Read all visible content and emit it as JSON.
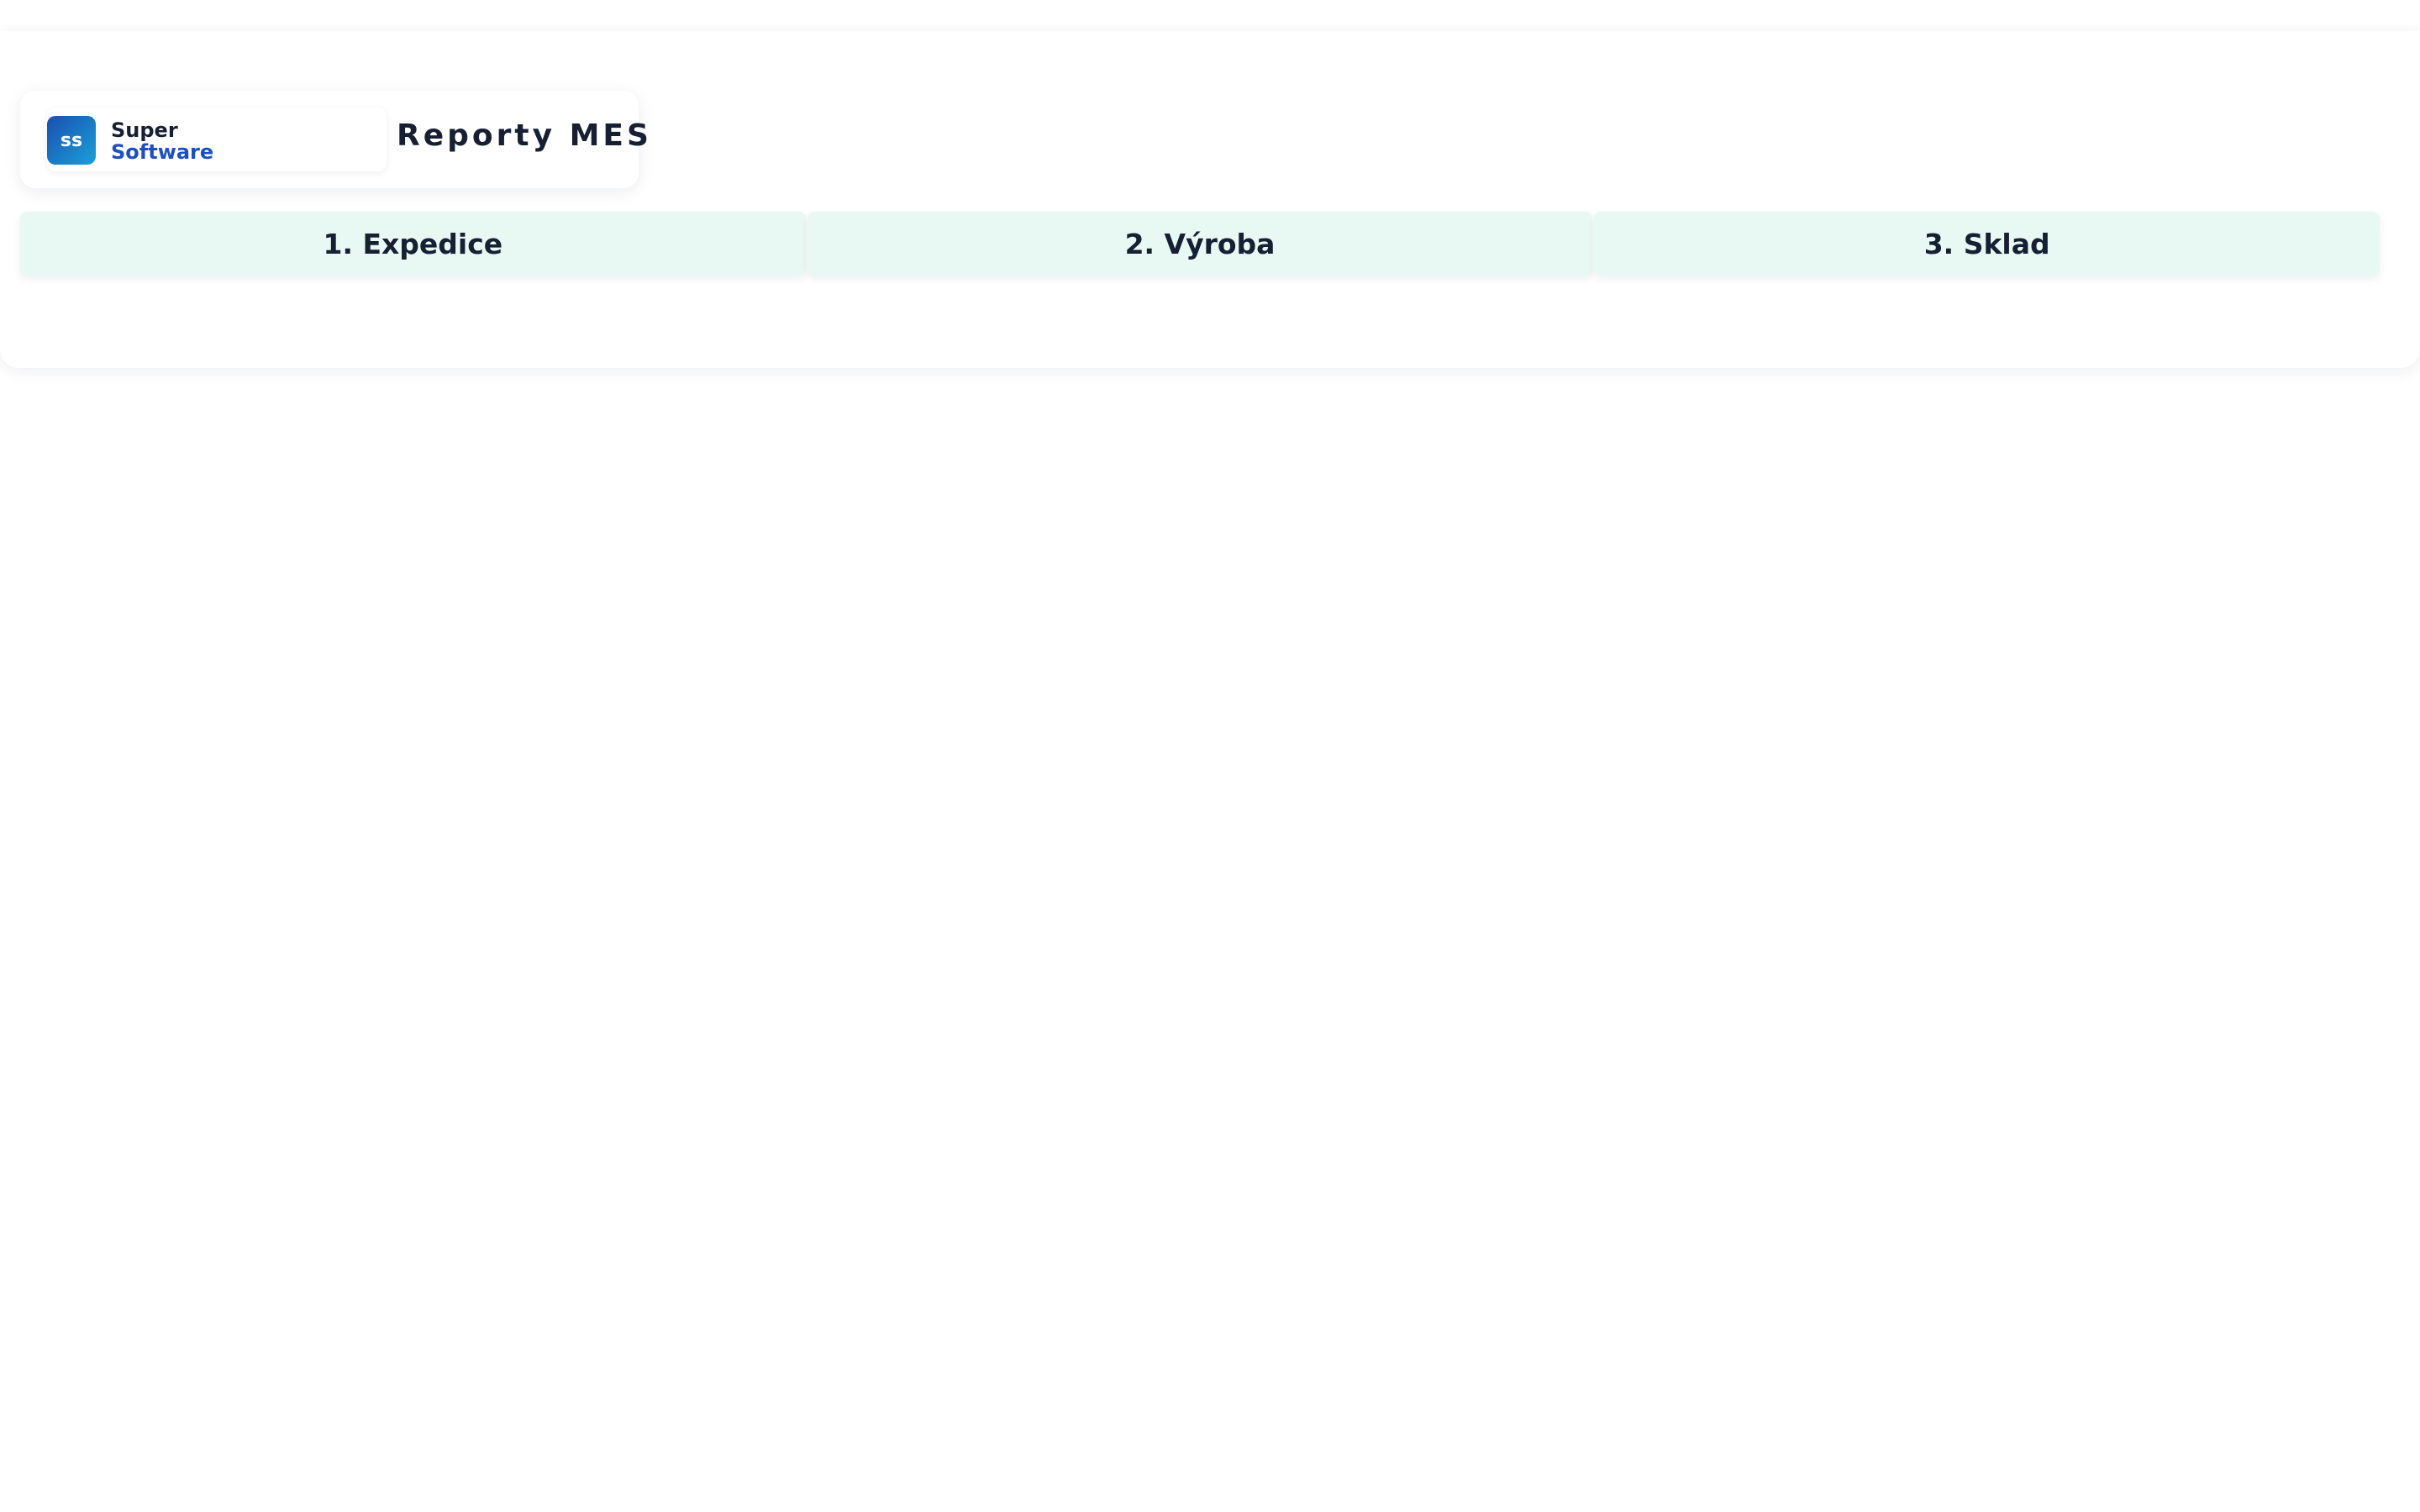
{
  "brand": {
    "logo_initials": "ss",
    "name_line1": "Super",
    "name_line2": "Software"
  },
  "header": {
    "title": "Reporty MES"
  },
  "tabs": [
    {
      "label": "1. Expedice"
    },
    {
      "label": "2. Výroba"
    },
    {
      "label": "3. Sklad"
    }
  ],
  "colors": {
    "tab_background": "#e8f9f4",
    "text_dark": "#172033",
    "brand_blue": "#1d4fbf",
    "logo_gradient_start": "#1a4fb0",
    "logo_gradient_end": "#1aa0d8"
  }
}
